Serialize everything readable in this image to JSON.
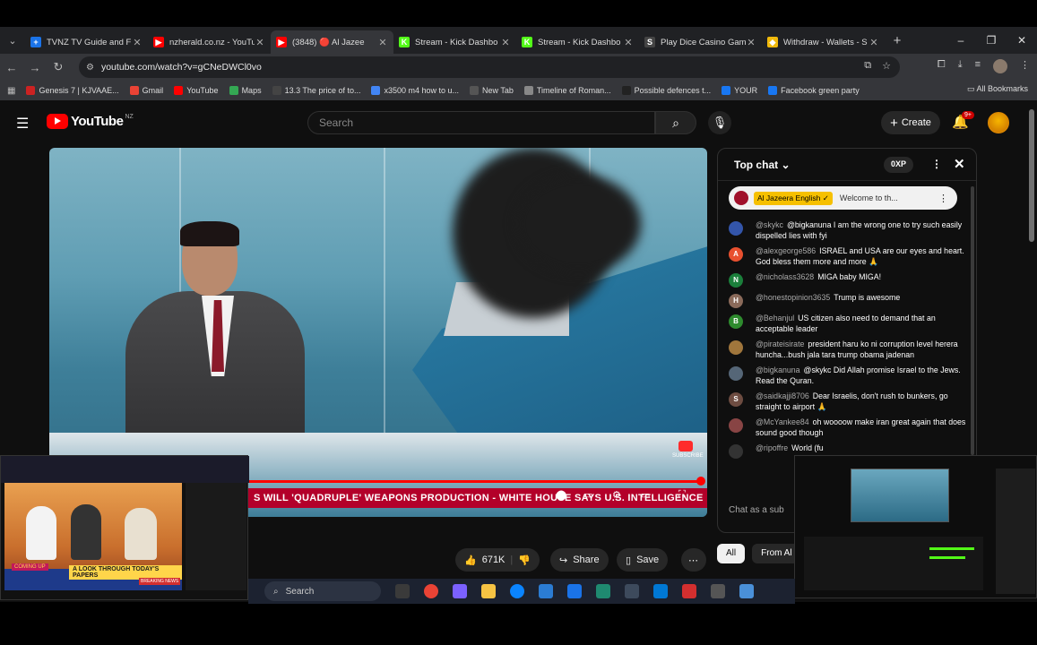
{
  "browser": {
    "tabs": [
      {
        "title": "TVNZ TV Guide and Fr",
        "icon_color": "#1a73e8",
        "glyph": "+"
      },
      {
        "title": "nzherald.co.nz - YouTu",
        "icon_color": "#ff0000",
        "glyph": "▶"
      },
      {
        "title": "(3848) 🔴 Al Jazee",
        "icon_color": "#ff0000",
        "glyph": "▶"
      },
      {
        "title": "Stream - Kick Dashbo",
        "icon_color": "#53fc18",
        "glyph": "K"
      },
      {
        "title": "Stream - Kick Dashbo",
        "icon_color": "#53fc18",
        "glyph": "K"
      },
      {
        "title": "Play Dice Casino Game",
        "icon_color": "#444444",
        "glyph": "S"
      },
      {
        "title": "Withdraw - Wallets - S",
        "icon_color": "#f0b90b",
        "glyph": "◆"
      }
    ],
    "url": "youtube.com/watch?v=gCNeDWCl0vo",
    "bookmarks": [
      {
        "label": "Genesis 7 | KJVAAE...",
        "icon_color": "#cc2222"
      },
      {
        "label": "Gmail",
        "icon_color": "#ea4335"
      },
      {
        "label": "YouTube",
        "icon_color": "#ff0000"
      },
      {
        "label": "Maps",
        "icon_color": "#34a853"
      },
      {
        "label": "13.3 The price of to...",
        "icon_color": "#444444"
      },
      {
        "label": "x3500 m4 how to u...",
        "icon_color": "#4285f4"
      },
      {
        "label": "New Tab",
        "icon_color": "#555555"
      },
      {
        "label": "Timeline of Roman...",
        "icon_color": "#888888"
      },
      {
        "label": "Possible defences t...",
        "icon_color": "#222222"
      },
      {
        "label": "YOUR",
        "icon_color": "#1877f2"
      },
      {
        "label": "Facebook green party",
        "icon_color": "#1877f2"
      }
    ],
    "all_bookmarks": "All Bookmarks"
  },
  "youtube": {
    "logo_text": "YouTube",
    "region": "NZ",
    "search_placeholder": "Search",
    "create_label": "Create",
    "notif_badge": "9+",
    "ticker_text": "S WILL 'QUADRUPLE' WEAPONS PRODUCTION  -  WHITE HOUSE SAYS U.S. INTELLIGENCE",
    "subscribe_watermark": "SUBSCRIBE",
    "likes": "671K",
    "share_label": "Share",
    "save_label": "Save",
    "chips": [
      "All",
      "From Al J"
    ]
  },
  "chat": {
    "title": "Top chat",
    "xp": "0XP",
    "pinned_name": "Al Jazeera English ✓",
    "pinned_text": "Welcome to th...",
    "input_placeholder": "Chat as a sub",
    "messages": [
      {
        "author": "@skykc",
        "text": "@bigkanuna I am the wrong one to try such easily dispelled lies with fyi",
        "av_color": "#3355aa",
        "initial": ""
      },
      {
        "author": "@alexgeorge586",
        "text": "ISRAEL and USA are our eyes and heart. God bless them more and more 🙏",
        "av_color": "#e8502f",
        "initial": "A"
      },
      {
        "author": "@nicholass3628",
        "text": "MIGA baby MIGA!",
        "av_color": "#1b7f3b",
        "initial": "N"
      },
      {
        "author": "@honestopinion3635",
        "text": "Trump is awesome",
        "av_color": "#8a6a5a",
        "initial": "H"
      },
      {
        "author": "@Behanjul",
        "text": "US citizen also need to demand that an acceptable leader",
        "av_color": "#2e8b2e",
        "initial": "B"
      },
      {
        "author": "@pirateisirate",
        "text": "president haru ko ni corruption level herera huncha...bush jala tara trump obama jadenan",
        "av_color": "#a0763c",
        "initial": ""
      },
      {
        "author": "@bigkanuna",
        "text": "@skykc Did Allah promise Israel to the Jews. Read the Quran.",
        "av_color": "#556677",
        "initial": ""
      },
      {
        "author": "@saidkajji8706",
        "text": "Dear Israelis, don't rush to bunkers, go straight to airport 🙏",
        "av_color": "#6d4c41",
        "initial": "S"
      },
      {
        "author": "@McYankee84",
        "text": "oh woooow make iran great again that does sound good though",
        "av_color": "#884444",
        "initial": ""
      },
      {
        "author": "@ripoffre",
        "text": "World (fu",
        "av_color": "#333333",
        "initial": ""
      }
    ]
  },
  "overlay_left": {
    "banner_top": "COMING UP",
    "banner_main": "A LOOK THROUGH TODAY'S PAPERS",
    "banner_tag": "BREAKING NEWS"
  },
  "taskbar": {
    "search_label": "Search"
  }
}
